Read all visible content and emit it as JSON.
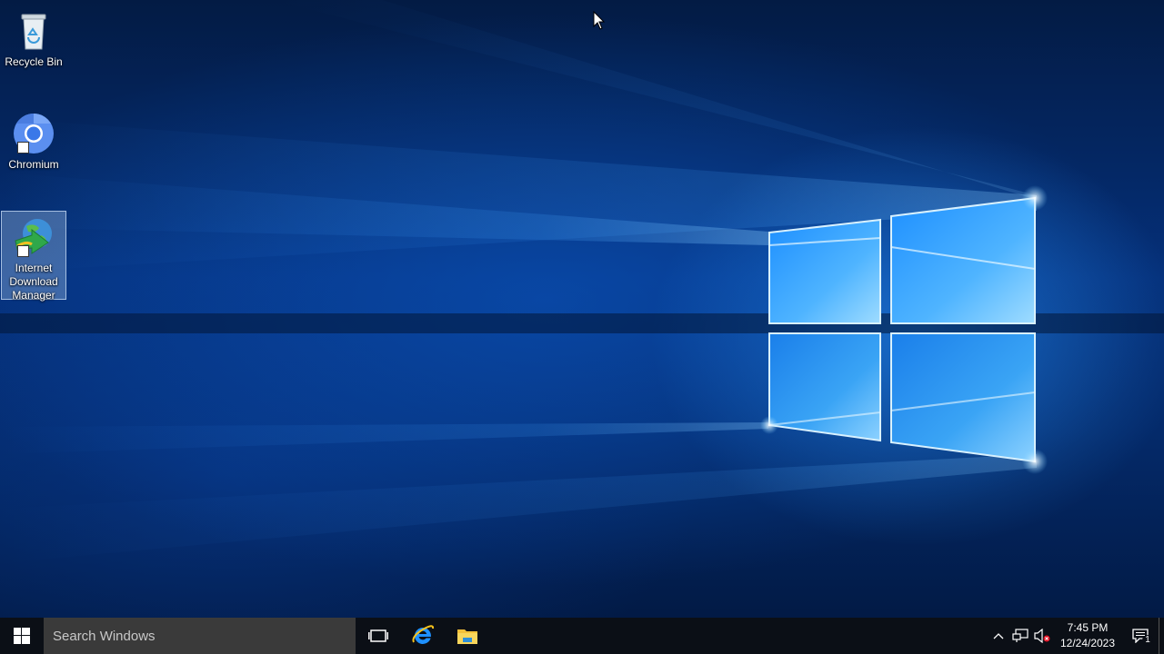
{
  "desktop": {
    "icons": [
      {
        "label": "Recycle Bin",
        "icon": "recycle-bin-icon"
      },
      {
        "label": "Chromium",
        "icon": "chromium-icon"
      },
      {
        "label": "Internet Download Manager",
        "icon": "idm-icon",
        "selected": true
      }
    ],
    "wallpaper": "windows-10-hero-light"
  },
  "taskbar": {
    "start_icon": "windows-logo-icon",
    "search": {
      "placeholder": "Search Windows",
      "value": ""
    },
    "pinned": [
      {
        "name": "Task View",
        "icon": "task-view-icon"
      },
      {
        "name": "Internet Explorer",
        "icon": "internet-explorer-icon"
      },
      {
        "name": "File Explorer",
        "icon": "file-explorer-icon"
      }
    ],
    "tray": {
      "icons": [
        "chevron-up-icon",
        "network-icon",
        "volume-muted-icon"
      ],
      "time": "7:45 PM",
      "date": "12/24/2023",
      "notification_count": "1"
    }
  },
  "colors": {
    "taskbar": "#0b0f16",
    "search_box": "#3a3a3a",
    "accent": "#1e90ff"
  }
}
